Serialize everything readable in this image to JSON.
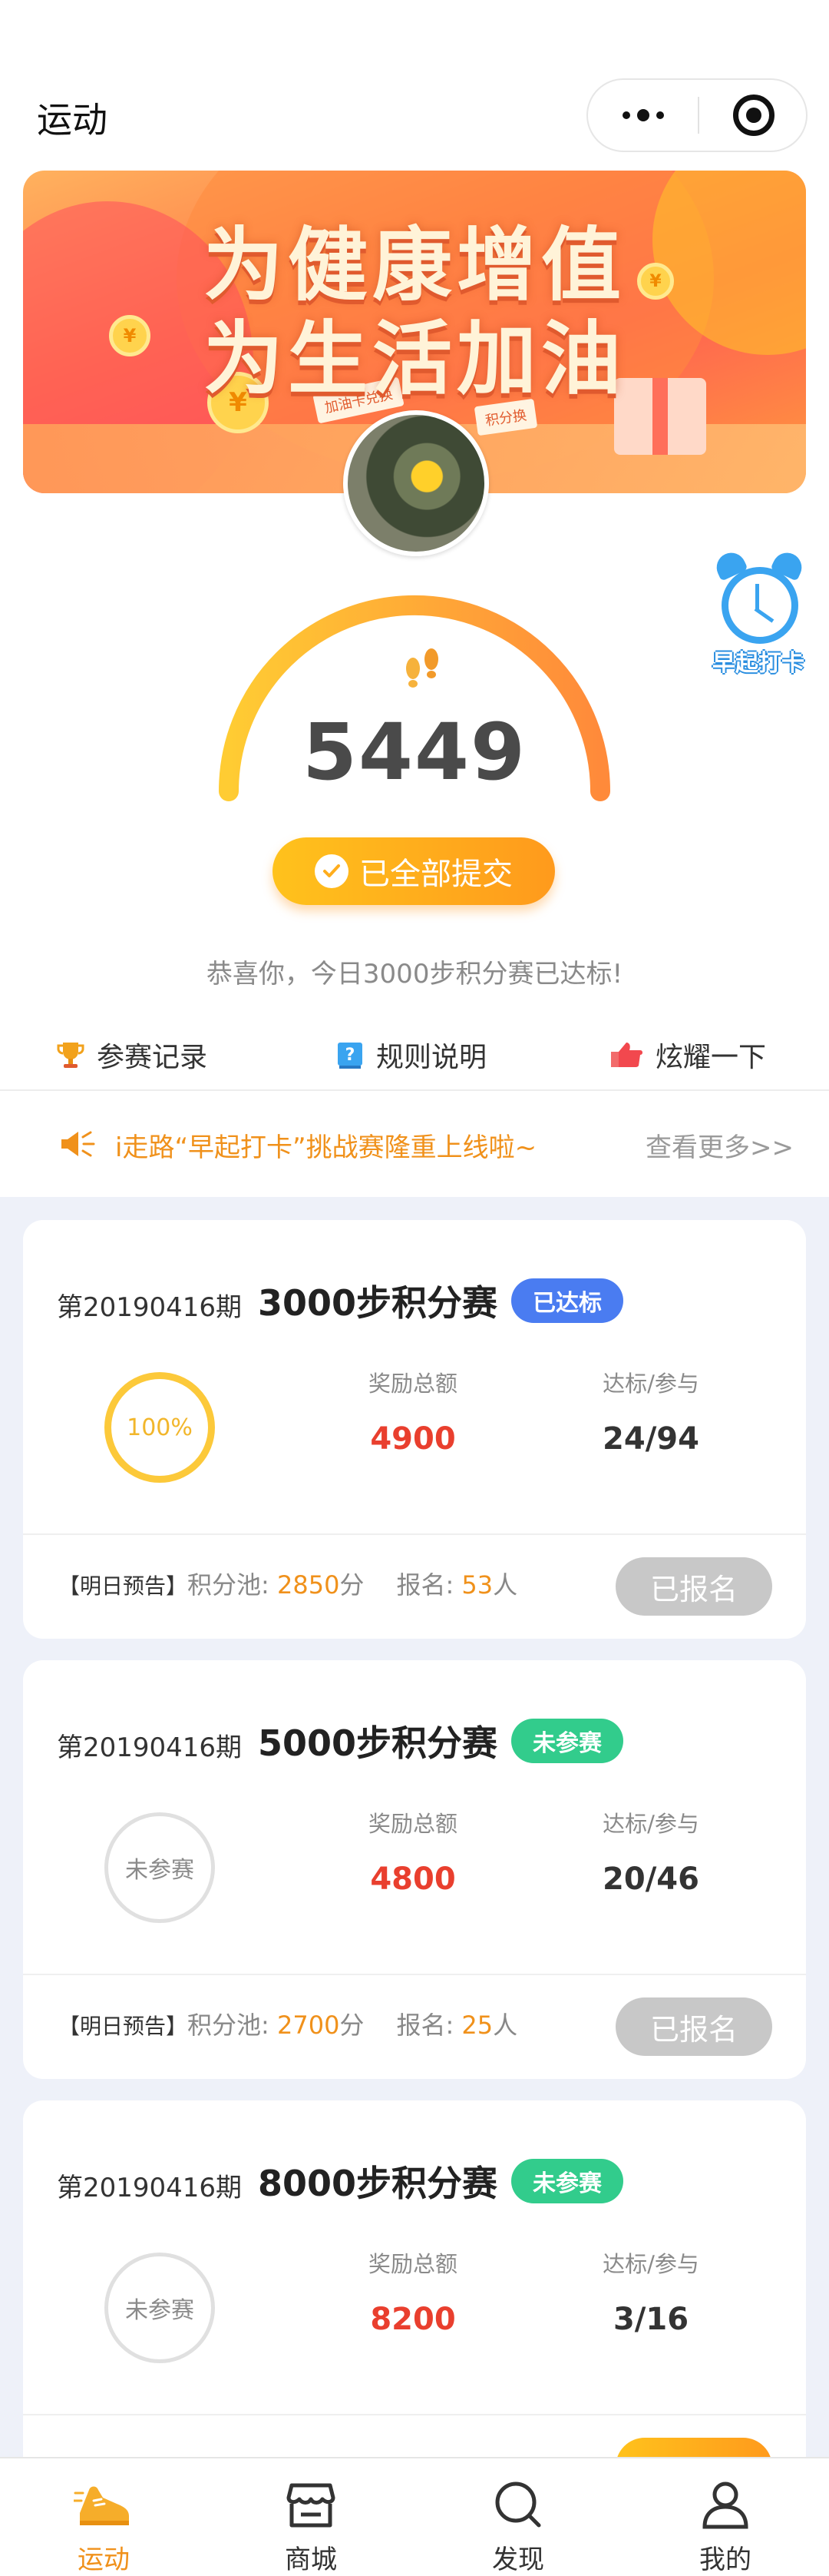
{
  "header": {
    "title": "运动"
  },
  "banner": {
    "line1": "为健康增值",
    "line2": "为生活加油",
    "tag_left": "加油卡兑换",
    "tag_right": "积分换"
  },
  "alarm_badge": {
    "label": "早起打卡"
  },
  "gauge": {
    "steps": "5449",
    "progress_fraction": 1.0
  },
  "submit_button": {
    "label": "已全部提交"
  },
  "congrats_text": "恭喜你，今日3000步积分赛已达标!",
  "quick_links": [
    {
      "label": "参赛记录",
      "icon": "trophy-icon"
    },
    {
      "label": "规则说明",
      "icon": "help-book-icon"
    },
    {
      "label": "炫耀一下",
      "icon": "thumbs-up-icon"
    }
  ],
  "notice": {
    "text": "i走路“早起打卡”挑战赛隆重上线啦~",
    "more": "查看更多>>"
  },
  "cards": [
    {
      "period": "第20190416期",
      "title": "3000步积分赛",
      "badge": "已达标",
      "ring_text": "100%",
      "reward_label": "奖励总额",
      "reward": "4900",
      "ratio_label": "达标/参与",
      "ratio": "24/94",
      "preview_label": "【明日预告】",
      "pool_label": "积分池: ",
      "pool_value": "2850",
      "pool_unit": "分",
      "signup_label": "报名: ",
      "signup_value": "53",
      "signup_unit": "人",
      "button": "已报名"
    },
    {
      "period": "第20190416期",
      "title": "5000步积分赛",
      "badge": "未参赛",
      "ring_text": "未参赛",
      "reward_label": "奖励总额",
      "reward": "4800",
      "ratio_label": "达标/参与",
      "ratio": "20/46",
      "preview_label": "【明日预告】",
      "pool_label": "积分池: ",
      "pool_value": "2700",
      "pool_unit": "分",
      "signup_label": "报名: ",
      "signup_value": "25",
      "signup_unit": "人",
      "button": "已报名"
    },
    {
      "period": "第20190416期",
      "title": "8000步积分赛",
      "badge": "未参赛",
      "ring_text": "未参赛",
      "reward_label": "奖励总额",
      "reward": "8200",
      "ratio_label": "达标/参与",
      "ratio": "3/16"
    }
  ],
  "tabbar": [
    {
      "label": "运动",
      "icon": "running-shoe-icon",
      "active": true
    },
    {
      "label": "商城",
      "icon": "shop-icon",
      "active": false
    },
    {
      "label": "发现",
      "icon": "search-icon",
      "active": false
    },
    {
      "label": "我的",
      "icon": "user-icon",
      "active": false
    }
  ],
  "colors": {
    "accent_orange": "#f0911b",
    "reward_red": "#e93f2e",
    "badge_blue": "#4a7cf1",
    "badge_green": "#32cc8c",
    "disabled_gray": "#c8c8c8",
    "card_bg": "#eef1f9"
  }
}
